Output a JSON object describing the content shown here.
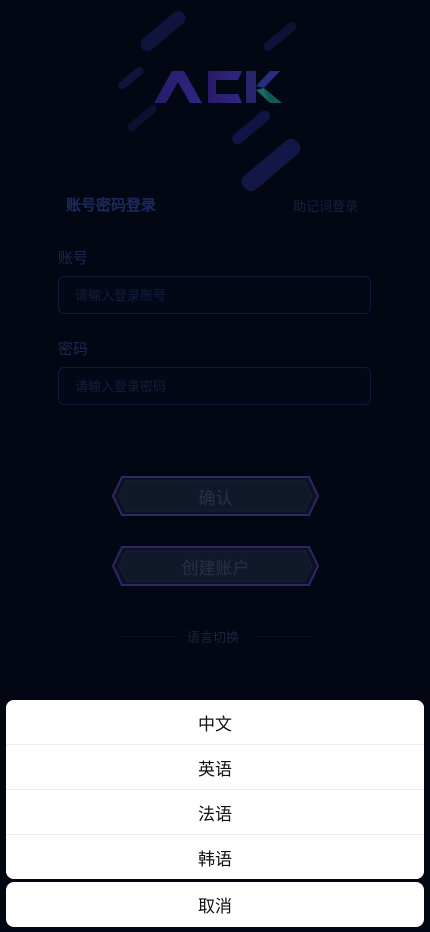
{
  "logo": {
    "text": "ACK"
  },
  "login_tabs": {
    "active": "账号密码登录",
    "other": "助记词登录"
  },
  "form": {
    "account_label": "账号",
    "account_placeholder": "请输入登录账号",
    "password_label": "密码",
    "password_placeholder": "请输入登录密码"
  },
  "buttons": {
    "confirm": "确认",
    "create_account": "创建账户"
  },
  "language_switch": {
    "label": "语言切换"
  },
  "action_sheet": {
    "options": [
      "中文",
      "英语",
      "法语",
      "韩语"
    ],
    "cancel": "取消"
  },
  "colors": {
    "background": "#050b1e",
    "accent": "#2f3f8e",
    "button_border": "#4a3a9c",
    "logo_teal": "#1fa69a",
    "sheet": "#ffffff"
  }
}
